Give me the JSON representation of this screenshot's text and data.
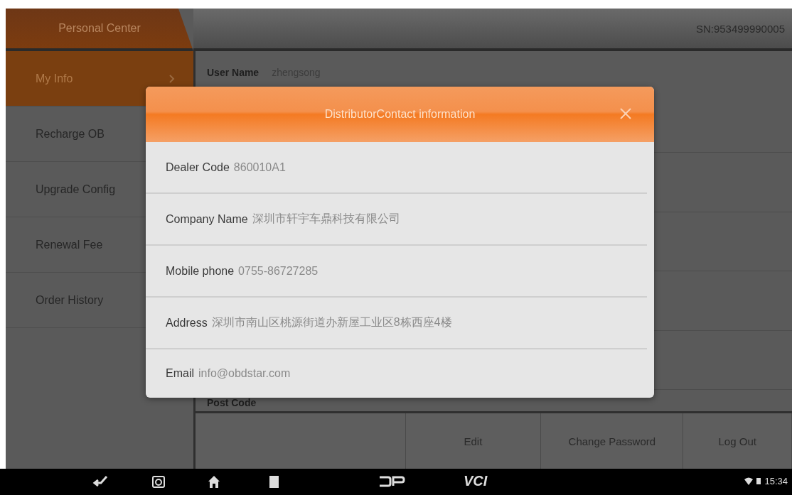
{
  "header": {
    "title": "Personal Center",
    "serial": "SN:953499990005"
  },
  "sidebar": {
    "items": [
      {
        "label": "My Info",
        "selected": true
      },
      {
        "label": "Recharge OB",
        "selected": false
      },
      {
        "label": "Upgrade Config",
        "selected": false
      },
      {
        "label": "Renewal Fee",
        "selected": false
      },
      {
        "label": "Order History",
        "selected": false
      }
    ]
  },
  "profile": {
    "fields": [
      {
        "label": "User Name",
        "value": "zhengsong"
      },
      {
        "label": "Post Code"
      }
    ]
  },
  "actions": [
    "Edit",
    "Change Password",
    "Log Out"
  ],
  "dialog": {
    "title": "DistributorContact information",
    "rows": [
      {
        "label": "Dealer Code",
        "value": "860010A1"
      },
      {
        "label": "Company Name",
        "value": "深圳市轩宇车鼎科技有限公司"
      },
      {
        "label": "Mobile phone",
        "value": "0755-86727285"
      },
      {
        "label": "Address",
        "value": "深圳市南山区桃源街道办新屋工业区8栋西座4楼"
      },
      {
        "label": "Email",
        "value": "info@obdstar.com"
      }
    ]
  },
  "navbar": {
    "brand": "VCI",
    "time": "15:34"
  }
}
